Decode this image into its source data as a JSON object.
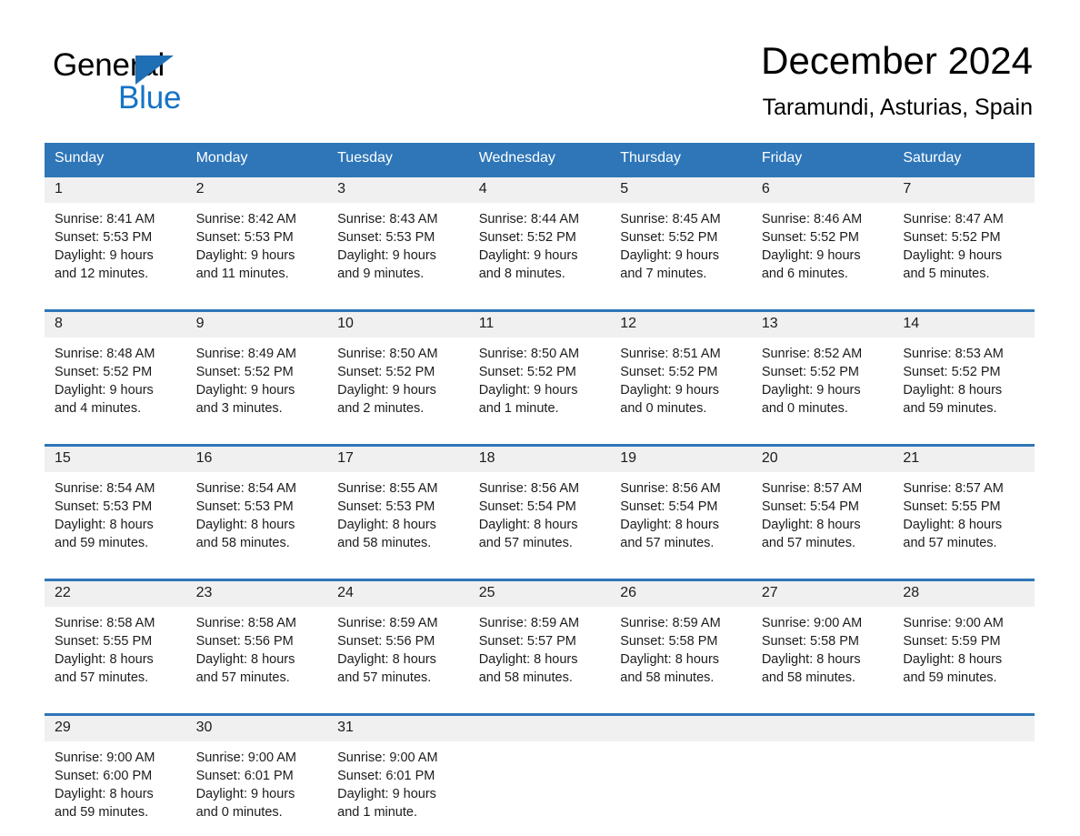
{
  "logo": {
    "word_top": "General",
    "word_bottom": "Blue",
    "triangle_color": "#1f6fb5",
    "blue_text_color": "#1573c6"
  },
  "header": {
    "month_title": "December 2024",
    "location": "Taramundi, Asturias, Spain"
  },
  "theme": {
    "header_blue": "#2e76b8",
    "daynum_band": "#f0f0f0",
    "text": "#1c1c1c",
    "page_background": "#ffffff"
  },
  "calendar": {
    "weekday_headers": [
      "Sunday",
      "Monday",
      "Tuesday",
      "Wednesday",
      "Thursday",
      "Friday",
      "Saturday"
    ],
    "weeks": [
      [
        {
          "day": "1",
          "sunrise": "Sunrise: 8:41 AM",
          "sunset": "Sunset: 5:53 PM",
          "daylight_1": "Daylight: 9 hours",
          "daylight_2": "and 12 minutes."
        },
        {
          "day": "2",
          "sunrise": "Sunrise: 8:42 AM",
          "sunset": "Sunset: 5:53 PM",
          "daylight_1": "Daylight: 9 hours",
          "daylight_2": "and 11 minutes."
        },
        {
          "day": "3",
          "sunrise": "Sunrise: 8:43 AM",
          "sunset": "Sunset: 5:53 PM",
          "daylight_1": "Daylight: 9 hours",
          "daylight_2": "and 9 minutes."
        },
        {
          "day": "4",
          "sunrise": "Sunrise: 8:44 AM",
          "sunset": "Sunset: 5:52 PM",
          "daylight_1": "Daylight: 9 hours",
          "daylight_2": "and 8 minutes."
        },
        {
          "day": "5",
          "sunrise": "Sunrise: 8:45 AM",
          "sunset": "Sunset: 5:52 PM",
          "daylight_1": "Daylight: 9 hours",
          "daylight_2": "and 7 minutes."
        },
        {
          "day": "6",
          "sunrise": "Sunrise: 8:46 AM",
          "sunset": "Sunset: 5:52 PM",
          "daylight_1": "Daylight: 9 hours",
          "daylight_2": "and 6 minutes."
        },
        {
          "day": "7",
          "sunrise": "Sunrise: 8:47 AM",
          "sunset": "Sunset: 5:52 PM",
          "daylight_1": "Daylight: 9 hours",
          "daylight_2": "and 5 minutes."
        }
      ],
      [
        {
          "day": "8",
          "sunrise": "Sunrise: 8:48 AM",
          "sunset": "Sunset: 5:52 PM",
          "daylight_1": "Daylight: 9 hours",
          "daylight_2": "and 4 minutes."
        },
        {
          "day": "9",
          "sunrise": "Sunrise: 8:49 AM",
          "sunset": "Sunset: 5:52 PM",
          "daylight_1": "Daylight: 9 hours",
          "daylight_2": "and 3 minutes."
        },
        {
          "day": "10",
          "sunrise": "Sunrise: 8:50 AM",
          "sunset": "Sunset: 5:52 PM",
          "daylight_1": "Daylight: 9 hours",
          "daylight_2": "and 2 minutes."
        },
        {
          "day": "11",
          "sunrise": "Sunrise: 8:50 AM",
          "sunset": "Sunset: 5:52 PM",
          "daylight_1": "Daylight: 9 hours",
          "daylight_2": "and 1 minute."
        },
        {
          "day": "12",
          "sunrise": "Sunrise: 8:51 AM",
          "sunset": "Sunset: 5:52 PM",
          "daylight_1": "Daylight: 9 hours",
          "daylight_2": "and 0 minutes."
        },
        {
          "day": "13",
          "sunrise": "Sunrise: 8:52 AM",
          "sunset": "Sunset: 5:52 PM",
          "daylight_1": "Daylight: 9 hours",
          "daylight_2": "and 0 minutes."
        },
        {
          "day": "14",
          "sunrise": "Sunrise: 8:53 AM",
          "sunset": "Sunset: 5:52 PM",
          "daylight_1": "Daylight: 8 hours",
          "daylight_2": "and 59 minutes."
        }
      ],
      [
        {
          "day": "15",
          "sunrise": "Sunrise: 8:54 AM",
          "sunset": "Sunset: 5:53 PM",
          "daylight_1": "Daylight: 8 hours",
          "daylight_2": "and 59 minutes."
        },
        {
          "day": "16",
          "sunrise": "Sunrise: 8:54 AM",
          "sunset": "Sunset: 5:53 PM",
          "daylight_1": "Daylight: 8 hours",
          "daylight_2": "and 58 minutes."
        },
        {
          "day": "17",
          "sunrise": "Sunrise: 8:55 AM",
          "sunset": "Sunset: 5:53 PM",
          "daylight_1": "Daylight: 8 hours",
          "daylight_2": "and 58 minutes."
        },
        {
          "day": "18",
          "sunrise": "Sunrise: 8:56 AM",
          "sunset": "Sunset: 5:54 PM",
          "daylight_1": "Daylight: 8 hours",
          "daylight_2": "and 57 minutes."
        },
        {
          "day": "19",
          "sunrise": "Sunrise: 8:56 AM",
          "sunset": "Sunset: 5:54 PM",
          "daylight_1": "Daylight: 8 hours",
          "daylight_2": "and 57 minutes."
        },
        {
          "day": "20",
          "sunrise": "Sunrise: 8:57 AM",
          "sunset": "Sunset: 5:54 PM",
          "daylight_1": "Daylight: 8 hours",
          "daylight_2": "and 57 minutes."
        },
        {
          "day": "21",
          "sunrise": "Sunrise: 8:57 AM",
          "sunset": "Sunset: 5:55 PM",
          "daylight_1": "Daylight: 8 hours",
          "daylight_2": "and 57 minutes."
        }
      ],
      [
        {
          "day": "22",
          "sunrise": "Sunrise: 8:58 AM",
          "sunset": "Sunset: 5:55 PM",
          "daylight_1": "Daylight: 8 hours",
          "daylight_2": "and 57 minutes."
        },
        {
          "day": "23",
          "sunrise": "Sunrise: 8:58 AM",
          "sunset": "Sunset: 5:56 PM",
          "daylight_1": "Daylight: 8 hours",
          "daylight_2": "and 57 minutes."
        },
        {
          "day": "24",
          "sunrise": "Sunrise: 8:59 AM",
          "sunset": "Sunset: 5:56 PM",
          "daylight_1": "Daylight: 8 hours",
          "daylight_2": "and 57 minutes."
        },
        {
          "day": "25",
          "sunrise": "Sunrise: 8:59 AM",
          "sunset": "Sunset: 5:57 PM",
          "daylight_1": "Daylight: 8 hours",
          "daylight_2": "and 58 minutes."
        },
        {
          "day": "26",
          "sunrise": "Sunrise: 8:59 AM",
          "sunset": "Sunset: 5:58 PM",
          "daylight_1": "Daylight: 8 hours",
          "daylight_2": "and 58 minutes."
        },
        {
          "day": "27",
          "sunrise": "Sunrise: 9:00 AM",
          "sunset": "Sunset: 5:58 PM",
          "daylight_1": "Daylight: 8 hours",
          "daylight_2": "and 58 minutes."
        },
        {
          "day": "28",
          "sunrise": "Sunrise: 9:00 AM",
          "sunset": "Sunset: 5:59 PM",
          "daylight_1": "Daylight: 8 hours",
          "daylight_2": "and 59 minutes."
        }
      ],
      [
        {
          "day": "29",
          "sunrise": "Sunrise: 9:00 AM",
          "sunset": "Sunset: 6:00 PM",
          "daylight_1": "Daylight: 8 hours",
          "daylight_2": "and 59 minutes."
        },
        {
          "day": "30",
          "sunrise": "Sunrise: 9:00 AM",
          "sunset": "Sunset: 6:01 PM",
          "daylight_1": "Daylight: 9 hours",
          "daylight_2": "and 0 minutes."
        },
        {
          "day": "31",
          "sunrise": "Sunrise: 9:00 AM",
          "sunset": "Sunset: 6:01 PM",
          "daylight_1": "Daylight: 9 hours",
          "daylight_2": "and 1 minute."
        },
        {
          "day": "",
          "sunrise": "",
          "sunset": "",
          "daylight_1": "",
          "daylight_2": ""
        },
        {
          "day": "",
          "sunrise": "",
          "sunset": "",
          "daylight_1": "",
          "daylight_2": ""
        },
        {
          "day": "",
          "sunrise": "",
          "sunset": "",
          "daylight_1": "",
          "daylight_2": ""
        },
        {
          "day": "",
          "sunrise": "",
          "sunset": "",
          "daylight_1": "",
          "daylight_2": ""
        }
      ]
    ]
  }
}
